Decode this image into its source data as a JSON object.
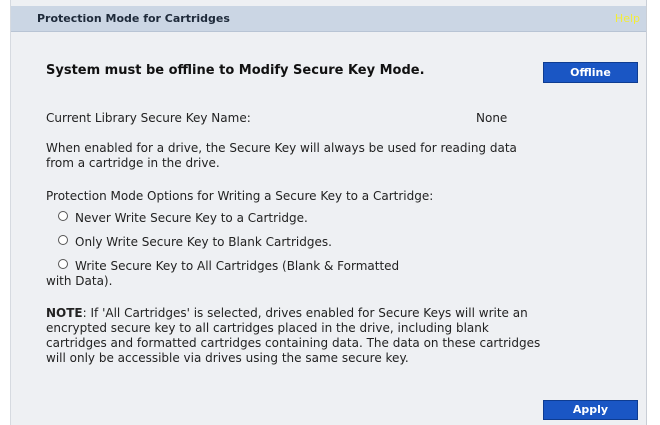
{
  "header": {
    "title": "Protection Mode for Cartridges",
    "help_label": "Help"
  },
  "offline": {
    "message": "System must be offline to Modify Secure Key Mode.",
    "button_label": "Offline"
  },
  "secure_key": {
    "label": "Current Library Secure Key Name:",
    "value": "None"
  },
  "description": "When enabled for a drive, the Secure Key will always be used for reading data from a cartridge in the drive.",
  "options": {
    "heading": "Protection Mode Options for Writing a Secure Key to a Cartridge:",
    "items": [
      {
        "label": "Never Write Secure Key to a Cartridge."
      },
      {
        "label": "Only Write Secure Key to Blank Cartridges."
      },
      {
        "label": "Write Secure Key to All Cartridges (Blank & Formatted",
        "continuation": "with Data)."
      }
    ]
  },
  "note": {
    "prefix": "NOTE",
    "text": ": If 'All Cartridges' is selected, drives enabled for Secure Keys will write an encrypted secure key to all cartridges placed in the drive, including blank cartridges and formatted cartridges containing data. The data on these cartridges will only be accessible via drives using the same secure key."
  },
  "apply_label": "Apply",
  "colors": {
    "panel_bg": "#eef0f3",
    "header_bg": "#cbd6e4",
    "help_text": "#f2ec3a",
    "button_bg": "#1a56c4"
  }
}
